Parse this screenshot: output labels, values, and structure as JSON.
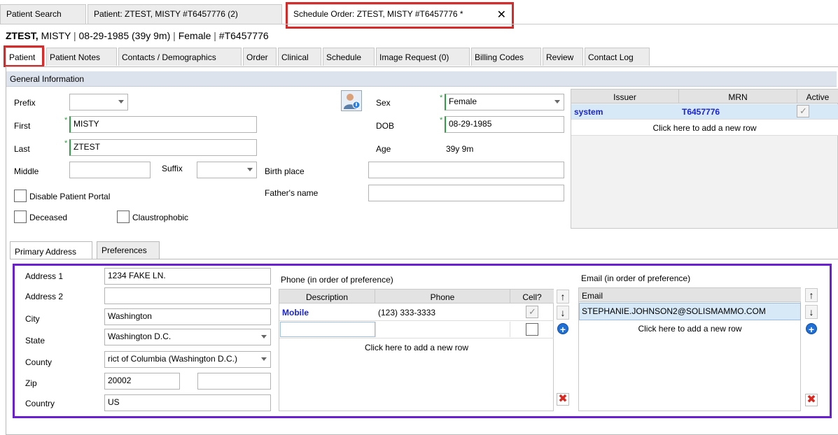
{
  "top_tabs": [
    {
      "label": "Patient Search"
    },
    {
      "label": "Patient: ZTEST, MISTY #T6457776 (2)"
    },
    {
      "label": "Schedule Order: ZTEST, MISTY #T6457776 *"
    }
  ],
  "close_glyph": "✕",
  "header": {
    "last": "ZTEST,",
    "first": "MISTY",
    "sep": "|",
    "dob": "08-29-1985 (39y 9m)",
    "sex": "Female",
    "mrn": "#T6457776"
  },
  "sub_tabs": [
    {
      "label": "Patient"
    },
    {
      "label": "Patient Notes"
    },
    {
      "label": "Contacts / Demographics"
    },
    {
      "label": "Order"
    },
    {
      "label": "Clinical"
    },
    {
      "label": "Schedule"
    },
    {
      "label": "Image Request (0)"
    },
    {
      "label": "Billing Codes"
    },
    {
      "label": "Review"
    },
    {
      "label": "Contact Log"
    }
  ],
  "general": {
    "section_title": "General Information",
    "prefix_label": "Prefix",
    "prefix_value": "",
    "first_label": "First",
    "first_value": "MISTY",
    "last_label": "Last",
    "last_value": "ZTEST",
    "middle_label": "Middle",
    "middle_value": "",
    "suffix_label": "Suffix",
    "suffix_value": "",
    "birth_place_label": "Birth place",
    "birth_place_value": "",
    "fathers_name_label": "Father's name",
    "fathers_name_value": "",
    "sex_label": "Sex",
    "sex_value": "Female",
    "dob_label": "DOB",
    "dob_value": "08-29-1985",
    "age_label": "Age",
    "age_value": "39y 9m",
    "disable_portal_label": "Disable Patient Portal",
    "deceased_label": "Deceased",
    "claustrophobic_label": "Claustrophobic",
    "required_mark": "*"
  },
  "issuer_grid": {
    "headers": [
      "Issuer",
      "MRN",
      "Active"
    ],
    "rows": [
      {
        "issuer": "system",
        "mrn": "T6457776",
        "active": true
      }
    ],
    "add_row": "Click here to add a new row"
  },
  "address_tabs": [
    {
      "label": "Primary Address"
    },
    {
      "label": "Preferences"
    }
  ],
  "address": {
    "address1_label": "Address 1",
    "address1_value": "1234 FAKE LN.",
    "address2_label": "Address 2",
    "address2_value": "",
    "city_label": "City",
    "city_value": "Washington",
    "state_label": "State",
    "state_value": "Washington D.C.",
    "county_label": "County",
    "county_value": "rict of Columbia (Washington D.C.)",
    "zip_label": "Zip",
    "zip_value": "20002",
    "zip_ext_value": "",
    "country_label": "Country",
    "country_value": "US"
  },
  "phone": {
    "title": "Phone (in order of preference)",
    "headers": [
      "Description",
      "Phone",
      "Cell?"
    ],
    "rows": [
      {
        "description": "Mobile",
        "phone": "(123) 333-3333",
        "cell": true
      }
    ],
    "add_row": "Click here to add a new row"
  },
  "email": {
    "title": "Email (in order of preference)",
    "header": "Email",
    "rows": [
      {
        "email": "STEPHANIE.JOHNSON2@SOLISMAMMO.COM"
      }
    ],
    "add_row": "Click here to add a new row"
  },
  "icons": {
    "up": "↑",
    "down": "↓",
    "plus": "+",
    "delete": "✖"
  },
  "colors": {
    "highlight_red": "#d62b2b",
    "highlight_purple": "#6a1fd0",
    "link_blue": "#1b25cf",
    "header_bg": "#dde3ec",
    "selected_row": "#d7e9f7"
  }
}
